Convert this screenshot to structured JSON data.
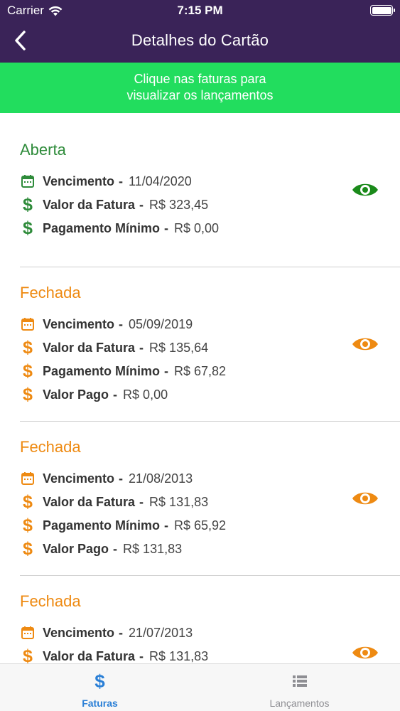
{
  "status_bar": {
    "carrier": "Carrier",
    "time": "7:15 PM"
  },
  "nav": {
    "title": "Detalhes do Cartão",
    "back_icon": "chevron-left-icon"
  },
  "banner": {
    "line1": "Clique nas faturas para",
    "line2": "visualizar os lançamentos",
    "background": "#22dd5e"
  },
  "colors": {
    "header": "#3a2358",
    "open": "#2e8b3a",
    "closed": "#ee8a12",
    "tab_active": "#2a7fd6",
    "tab_inactive": "#8e8e93"
  },
  "invoices": [
    {
      "status": "Aberta",
      "fields": [
        {
          "icon": "calendar-icon",
          "label": "Vencimento",
          "value": "11/04/2020"
        },
        {
          "icon": "dollar-icon",
          "label": "Valor da Fatura",
          "value": "R$ 323,45"
        },
        {
          "icon": "dollar-icon",
          "label": "Pagamento Mínimo",
          "value": "R$ 0,00"
        }
      ]
    },
    {
      "status": "Fechada",
      "fields": [
        {
          "icon": "calendar-icon",
          "label": "Vencimento",
          "value": "05/09/2019"
        },
        {
          "icon": "dollar-icon",
          "label": "Valor da Fatura",
          "value": "R$ 135,64"
        },
        {
          "icon": "dollar-icon",
          "label": "Pagamento Mínimo",
          "value": "R$ 67,82"
        },
        {
          "icon": "dollar-icon",
          "label": "Valor Pago",
          "value": "R$ 0,00"
        }
      ]
    },
    {
      "status": "Fechada",
      "fields": [
        {
          "icon": "calendar-icon",
          "label": "Vencimento",
          "value": "21/08/2013"
        },
        {
          "icon": "dollar-icon",
          "label": "Valor da Fatura",
          "value": "R$ 131,83"
        },
        {
          "icon": "dollar-icon",
          "label": "Pagamento Mínimo",
          "value": "R$ 65,92"
        },
        {
          "icon": "dollar-icon",
          "label": "Valor Pago",
          "value": "R$ 131,83"
        }
      ]
    },
    {
      "status": "Fechada",
      "fields": [
        {
          "icon": "calendar-icon",
          "label": "Vencimento",
          "value": "21/07/2013"
        },
        {
          "icon": "dollar-icon",
          "label": "Valor da Fatura",
          "value": "R$ 131,83"
        }
      ]
    }
  ],
  "separator": "-",
  "tabs": [
    {
      "label": "Faturas",
      "icon": "dollar-icon",
      "active": true
    },
    {
      "label": "Lançamentos",
      "icon": "list-icon",
      "active": false
    }
  ]
}
